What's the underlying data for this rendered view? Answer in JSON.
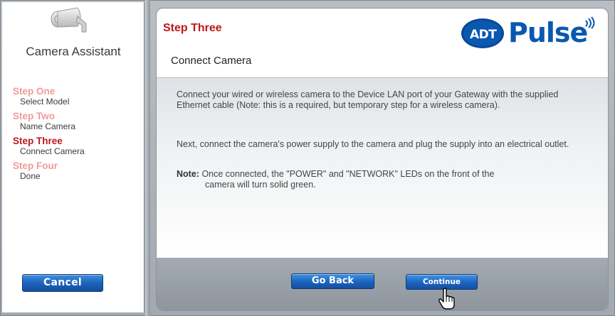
{
  "sidebar": {
    "title": "Camera Assistant",
    "steps": [
      {
        "name": "Step One",
        "desc": "Select Model",
        "active": false
      },
      {
        "name": "Step Two",
        "desc": "Name Camera",
        "active": false
      },
      {
        "name": "Step Three",
        "desc": "Connect Camera",
        "active": true
      },
      {
        "name": "Step Four",
        "desc": "Done",
        "active": false
      }
    ],
    "cancel_label": "Cancel"
  },
  "main": {
    "step_title": "Step Three",
    "section_title": "Connect Camera",
    "logo": {
      "badge": "ADT",
      "wordmark": "Pulse"
    },
    "paragraphs": [
      "Connect your wired or wireless camera to the Device LAN port of your Gateway with the supplied Ethernet cable (Note: this is a required, but temporary step for a wireless camera).",
      "Next, connect the camera's power supply to the camera and plug the supply into an electrical outlet."
    ],
    "note_label": "Note:",
    "note_text": "Once connected, the \"POWER\" and \"NETWORK\" LEDs on the front of the",
    "note_text_cont": "camera will turn solid green."
  },
  "footer": {
    "back_label": "Go Back",
    "continue_label": "Continue"
  },
  "colors": {
    "accent_red": "#c0161a",
    "inactive_step": "#f19a9a",
    "button_blue": "#1b63bd",
    "brand_blue": "#0a58b0"
  },
  "icons": [
    "security-camera-icon",
    "pulse-waves-icon",
    "hand-pointer-cursor-icon"
  ]
}
